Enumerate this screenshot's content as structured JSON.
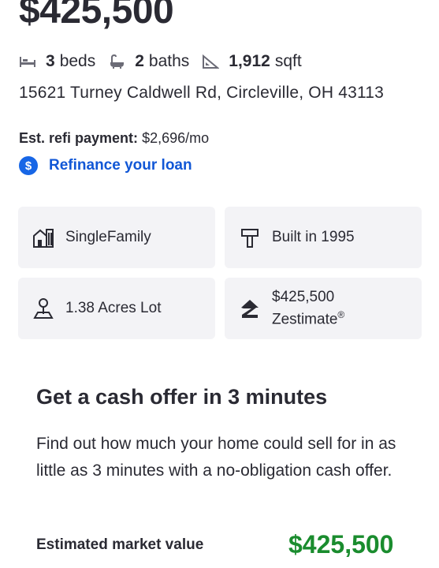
{
  "listing": {
    "price": "$425,500",
    "beds": {
      "value": "3",
      "label": "beds"
    },
    "baths": {
      "value": "2",
      "label": "baths"
    },
    "sqft": {
      "value": "1,912",
      "label": "sqft"
    },
    "address": "15621 Turney Caldwell Rd, Circleville, OH 43113"
  },
  "refi": {
    "label": "Est. refi payment:",
    "value": "$2,696/mo",
    "link_label": "Refinance your loan",
    "badge": "$"
  },
  "details": {
    "home_type": "SingleFamily",
    "built": "Built in 1995",
    "lot": "1.38 Acres Lot",
    "zestimate_value": "$425,500",
    "zestimate_label": "Zestimate"
  },
  "cash_offer": {
    "title": "Get a cash offer in 3 minutes",
    "description": "Find out how much your home could sell for in as little as 3 minutes with a no-obligation cash offer.",
    "market_value_label": "Estimated market value",
    "market_value": "$425,500"
  },
  "icons": [
    "bed-icon",
    "bath-icon",
    "sqft-icon",
    "house-icon",
    "hammer-icon",
    "tree-lot-icon",
    "zillow-logo-icon",
    "dollar-icon"
  ],
  "colors": {
    "link": "#1157d6",
    "badge": "#1766e6",
    "card_bg": "#f3f3f6",
    "market_value": "#1a8c2e",
    "text": "#2a2a33"
  }
}
